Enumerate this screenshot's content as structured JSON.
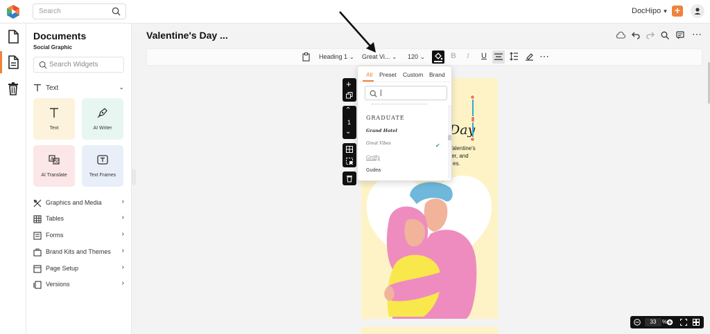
{
  "app": {
    "search_placeholder": "Search",
    "brand_name": "DocHipo",
    "colors": {
      "accent": "#f0823c",
      "toolbar_dark": "#111111",
      "selection": "#33a7d8",
      "check": "#2e9d78"
    }
  },
  "rail": {
    "items": [
      {
        "name": "document-icon"
      },
      {
        "name": "widgets-icon",
        "active": true
      },
      {
        "name": "trash-icon"
      }
    ]
  },
  "panel": {
    "title": "Documents",
    "subtitle": "Social Graphic",
    "search_placeholder": "Search Widgets",
    "text_section": "Text",
    "tiles": [
      {
        "label": "Text",
        "icon": "text-icon",
        "bg": "#fdf3dc"
      },
      {
        "label": "AI Writer",
        "icon": "pen-icon",
        "bg": "#e8f6f2"
      },
      {
        "label": "AI Translate",
        "icon": "translate-icon",
        "bg": "#fbe6e8"
      },
      {
        "label": "Text Frames",
        "icon": "text-frame-icon",
        "bg": "#e9eff8"
      }
    ],
    "menu": [
      {
        "label": "Graphics and Media",
        "icon": "graphics-icon"
      },
      {
        "label": "Tables",
        "icon": "table-icon"
      },
      {
        "label": "Forms",
        "icon": "form-icon"
      },
      {
        "label": "Brand Kits and Themes",
        "icon": "brand-kit-icon"
      },
      {
        "label": "Page Setup",
        "icon": "page-setup-icon"
      },
      {
        "label": "Versions",
        "icon": "versions-icon"
      }
    ]
  },
  "doc": {
    "title": "Valentine's Day ..."
  },
  "toolbar": {
    "style": "Heading 1",
    "font": "Great Vi...",
    "size": "120"
  },
  "font_dropdown": {
    "tabs": [
      "All",
      "Preset",
      "Custom",
      "Brand"
    ],
    "active_tab": "All",
    "fonts": [
      "Graduate",
      "Grand Hotel",
      "Great Vibes",
      "Griffy",
      "Gudea"
    ],
    "selected": "Great Vibes"
  },
  "canvas": {
    "heading_fragment": "Day",
    "body_lines": [
      "al Valentine's",
      "ter, and",
      "es."
    ],
    "page_number": "1"
  },
  "zoom": {
    "value": "33",
    "unit": "%"
  }
}
